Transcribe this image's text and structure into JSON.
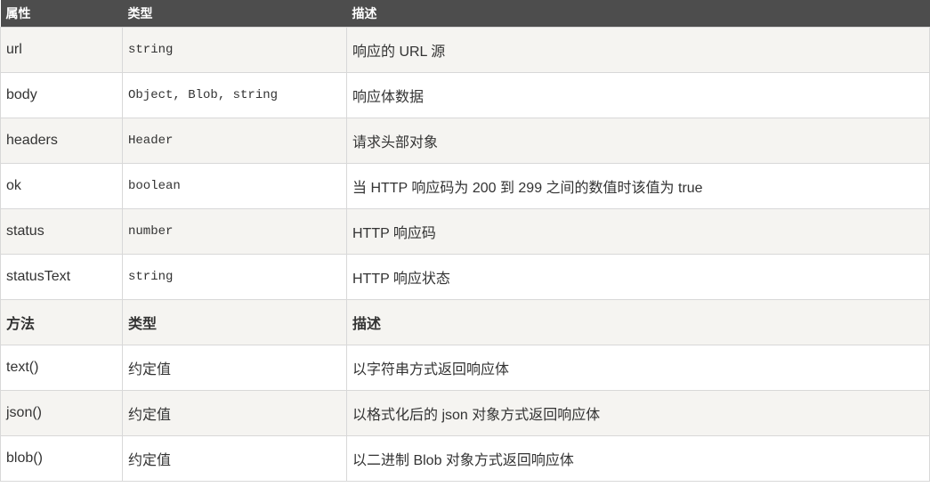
{
  "header": {
    "col1": "属性",
    "col2": "类型",
    "col3": "描述"
  },
  "properties": [
    {
      "name": "url",
      "type": "string",
      "desc": "响应的 URL 源"
    },
    {
      "name": "body",
      "type": "Object, Blob, string",
      "desc": "响应体数据"
    },
    {
      "name": "headers",
      "type": "Header",
      "desc": "请求头部对象"
    },
    {
      "name": "ok",
      "type": "boolean",
      "desc": "当 HTTP 响应码为 200 到 299 之间的数值时该值为 true"
    },
    {
      "name": "status",
      "type": "number",
      "desc": "HTTP 响应码"
    },
    {
      "name": "statusText",
      "type": "string",
      "desc": "HTTP 响应状态"
    }
  ],
  "methods_header": {
    "col1": "方法",
    "col2": "类型",
    "col3": "描述"
  },
  "methods": [
    {
      "name": "text()",
      "type": "约定值",
      "desc": "以字符串方式返回响应体"
    },
    {
      "name": "json()",
      "type": "约定值",
      "desc": "以格式化后的 json 对象方式返回响应体"
    },
    {
      "name": "blob()",
      "type": "约定值",
      "desc": "以二进制 Blob 对象方式返回响应体"
    }
  ]
}
